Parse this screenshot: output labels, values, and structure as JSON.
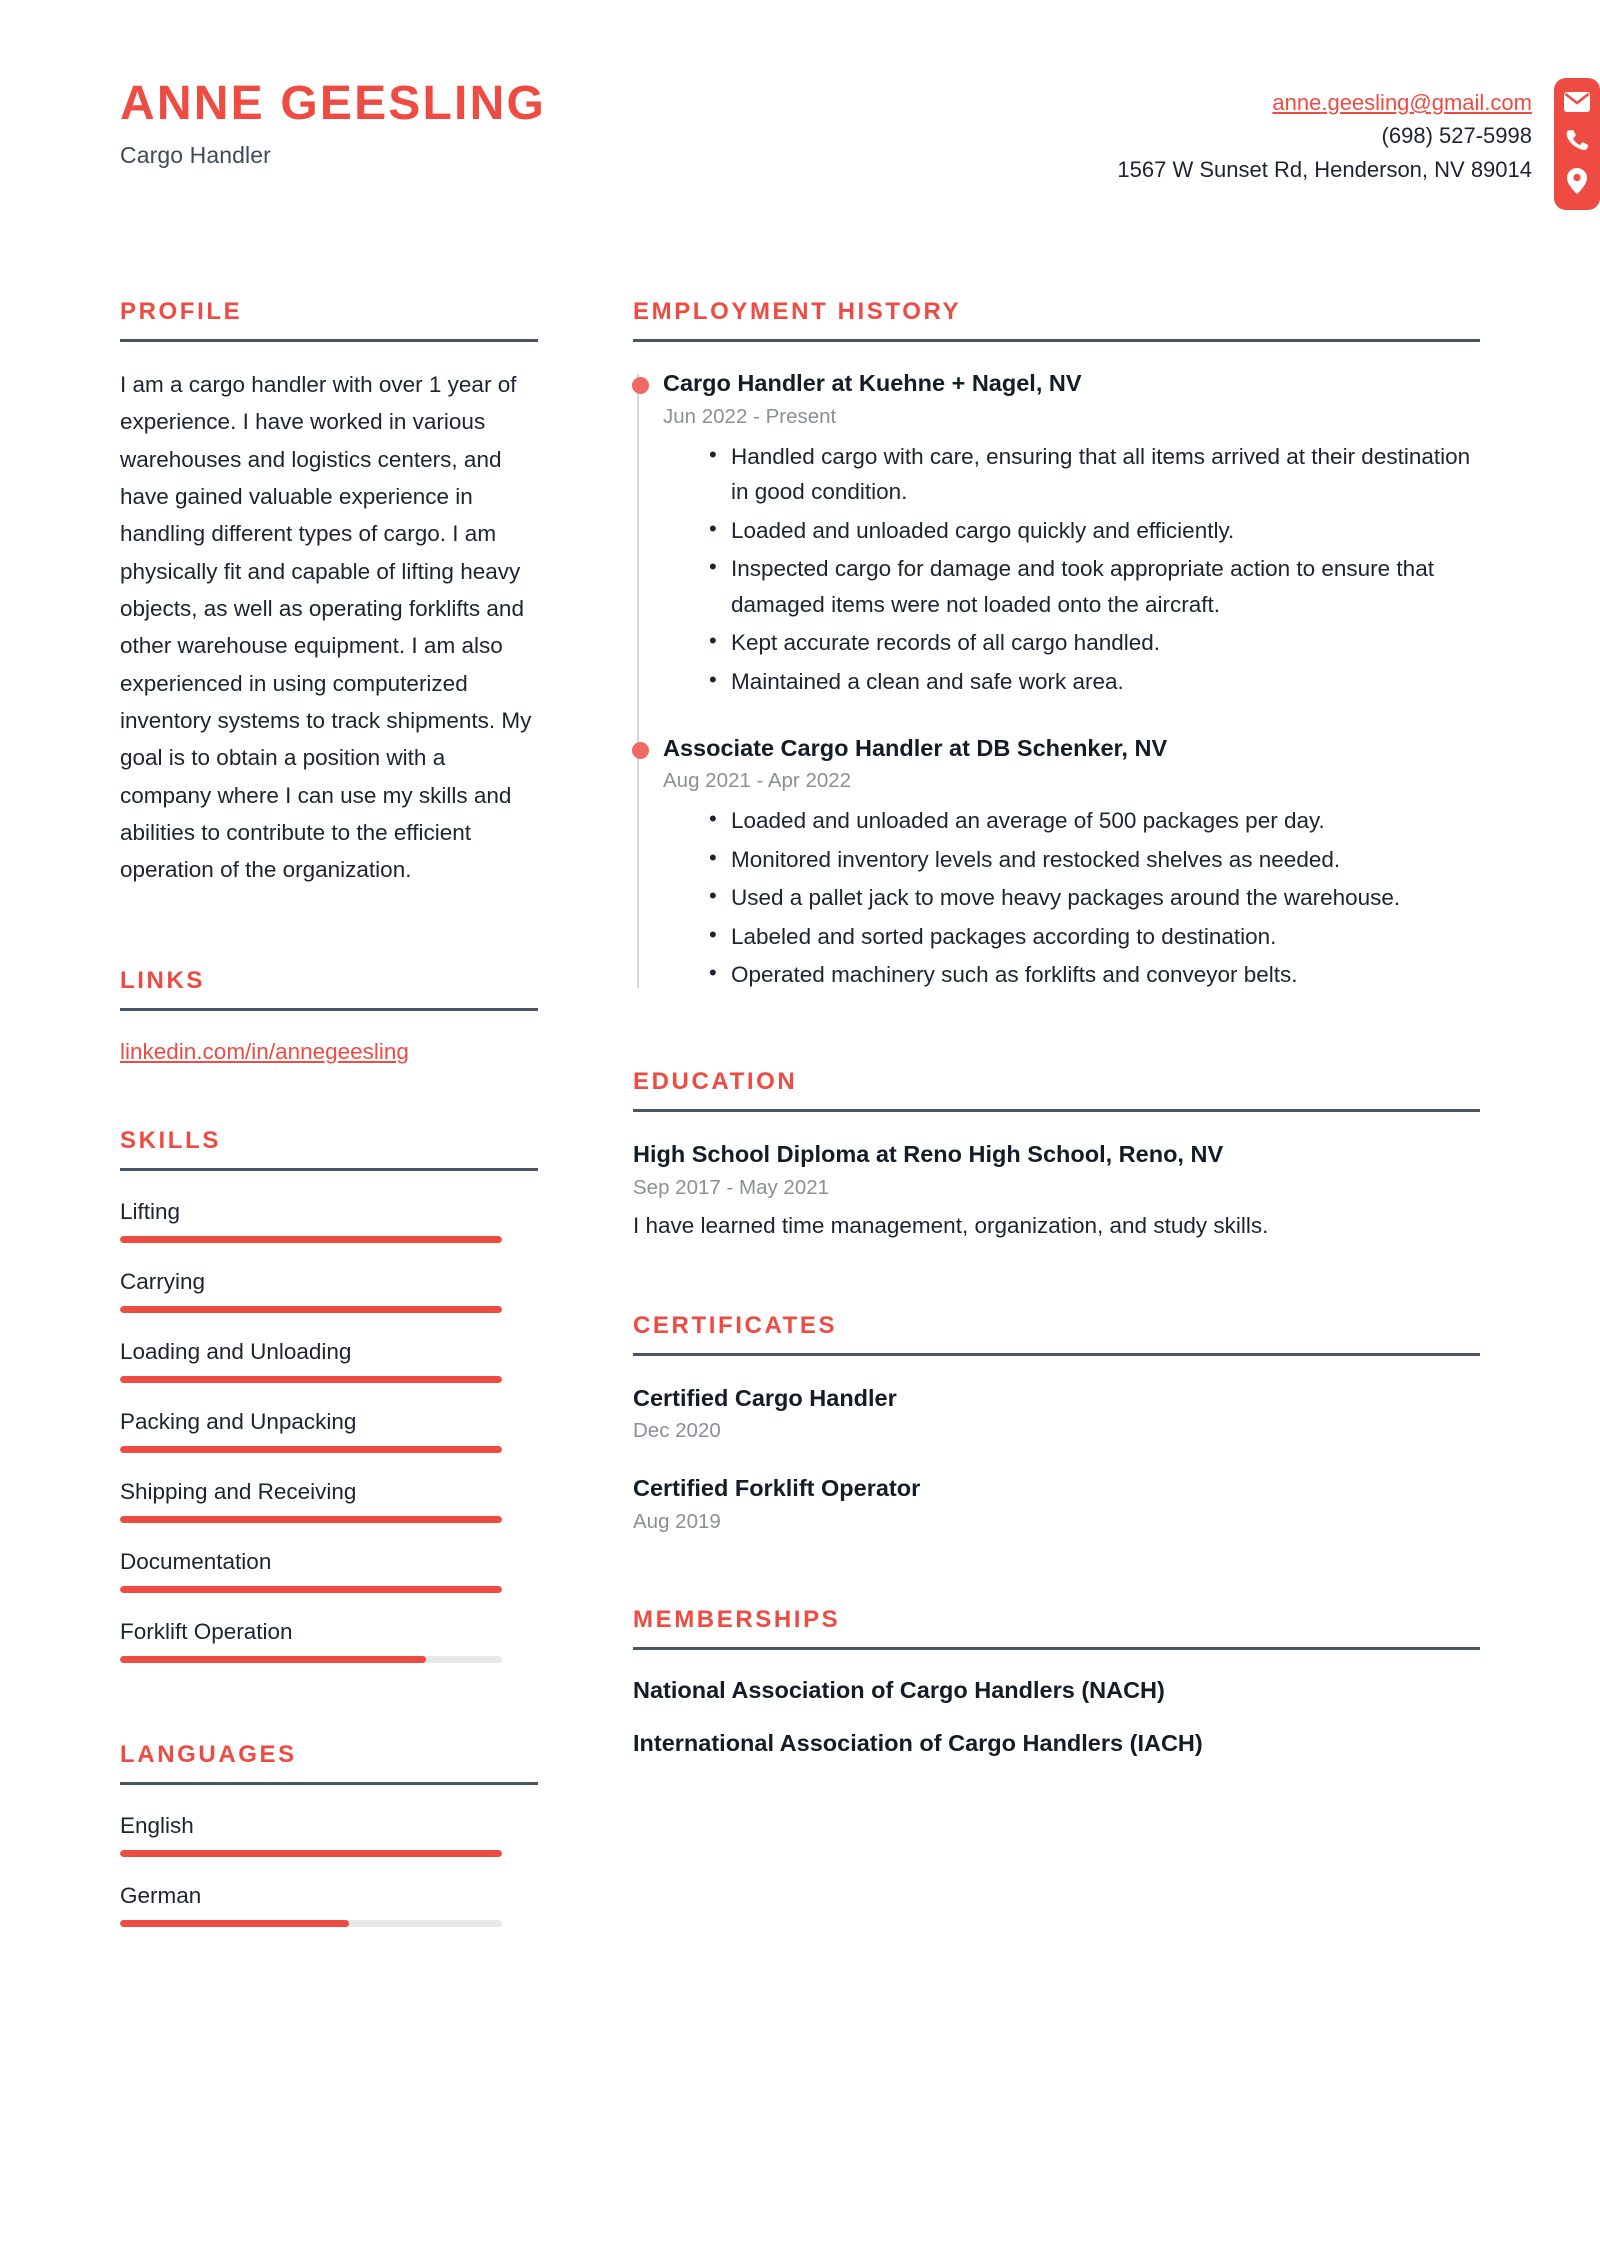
{
  "theme": {
    "accent": "#ee4b42",
    "rule": "#4a5568",
    "text": "#1c2430",
    "muted": "#8b8f96",
    "track": "#e8e8e8"
  },
  "header": {
    "name": "ANNE GEESLING",
    "title": "Cargo Handler",
    "email": "anne.geesling@gmail.com",
    "phone": "(698) 527-5998",
    "address": "1567 W Sunset Rd, Henderson, NV 89014",
    "icons": [
      "envelope-icon",
      "phone-icon",
      "location-pin-icon"
    ]
  },
  "sections": {
    "profile": "PROFILE",
    "links": "LINKS",
    "skills": "SKILLS",
    "languages": "LANGUAGES",
    "employment": "EMPLOYMENT HISTORY",
    "education": "EDUCATION",
    "certificates": "CERTIFICATES",
    "memberships": "MEMBERSHIPS"
  },
  "profile": {
    "text": "I am a cargo handler with over 1 year of experience. I have worked in various warehouses and logistics centers, and have gained valuable experience in handling different types of cargo. I am physically fit and capable of lifting heavy objects, as well as operating forklifts and other warehouse equipment. I am also experienced in using computerized inventory systems to track shipments. My goal is to obtain a position with a company where I can use my skills and abilities to contribute to the efficient operation of the organization."
  },
  "links": [
    {
      "label": "linkedin.com/in/annegeesling"
    }
  ],
  "skills": [
    {
      "label": "Lifting",
      "level": 100
    },
    {
      "label": "Carrying",
      "level": 100
    },
    {
      "label": "Loading and Unloading",
      "level": 100
    },
    {
      "label": "Packing and Unpacking",
      "level": 100
    },
    {
      "label": "Shipping and Receiving",
      "level": 100
    },
    {
      "label": "Documentation",
      "level": 100
    },
    {
      "label": "Forklift Operation",
      "level": 80
    }
  ],
  "languages": [
    {
      "label": "English",
      "level": 100
    },
    {
      "label": "German",
      "level": 60
    }
  ],
  "employment": [
    {
      "title": "Cargo Handler at Kuehne + Nagel, NV",
      "date": "Jun 2022 - Present",
      "bullets": [
        "Handled cargo with care, ensuring that all items arrived at their destination in good condition.",
        "Loaded and unloaded cargo quickly and efficiently.",
        "Inspected cargo for damage and took appropriate action to ensure that damaged items were not loaded onto the aircraft.",
        "Kept accurate records of all cargo handled.",
        "Maintained a clean and safe work area."
      ]
    },
    {
      "title": "Associate Cargo Handler at DB Schenker, NV",
      "date": "Aug 2021 - Apr 2022",
      "bullets": [
        "Loaded and unloaded an average of 500 packages per day.",
        "Monitored inventory levels and restocked shelves as needed.",
        "Used a pallet jack to move heavy packages around the warehouse.",
        "Labeled and sorted packages according to destination.",
        "Operated machinery such as forklifts and conveyor belts."
      ]
    }
  ],
  "education": [
    {
      "title": "High School Diploma at Reno High School, Reno, NV",
      "date": "Sep 2017 - May 2021",
      "description": "I have learned time management, organization, and study skills."
    }
  ],
  "certificates": [
    {
      "title": "Certified Cargo Handler",
      "date": "Dec 2020"
    },
    {
      "title": "Certified Forklift Operator",
      "date": "Aug 2019"
    }
  ],
  "memberships": [
    {
      "title": "National Association of Cargo Handlers (NACH)"
    },
    {
      "title": "International Association of Cargo Handlers (IACH)"
    }
  ]
}
